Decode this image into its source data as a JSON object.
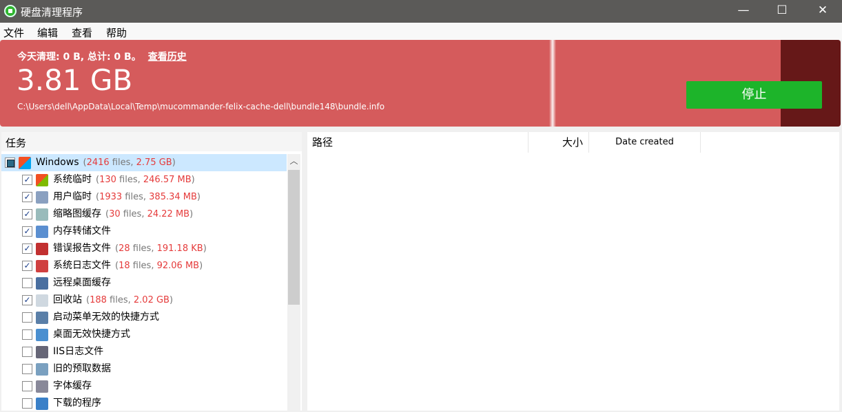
{
  "window": {
    "title": "硬盘清理程序",
    "minimize": "—",
    "maximize": "☐",
    "close": "✕"
  },
  "menu": [
    "文件",
    "编辑",
    "查看",
    "帮助"
  ],
  "banner": {
    "today_text": "今天清理: 0 B, 总计: 0 B。",
    "history_link": "查看历史",
    "size": "3.81 GB",
    "current_path": "C:\\Users\\dell\\AppData\\Local\\Temp\\mucommander-felix-cache-dell\\bundle148\\bundle.info",
    "stop_label": "停止",
    "colors": {
      "banner": "#d55b5c",
      "stop": "#1db42a"
    }
  },
  "tasks": {
    "header": "任务",
    "root": {
      "label": "Windows",
      "files": "2416 files",
      "size": "2.75 GB",
      "icon": "windows-flag-icon"
    },
    "items": [
      {
        "label": "系统临时",
        "files": "130 files",
        "size": "246.57 MB",
        "checked": true,
        "icon": "windows-flag-icon"
      },
      {
        "label": "用户临时",
        "files": "1933 files",
        "size": "385.34 MB",
        "checked": true,
        "icon": "user-file-icon"
      },
      {
        "label": "缩略图缓存",
        "files": "30 files",
        "size": "24.22 MB",
        "checked": true,
        "icon": "thumbnail-icon"
      },
      {
        "label": "内存转储文件",
        "checked": true,
        "icon": "memory-dump-icon"
      },
      {
        "label": "错误报告文件",
        "files": "28 files",
        "size": "191.18 KB",
        "checked": true,
        "icon": "toolbox-icon"
      },
      {
        "label": "系统日志文件",
        "files": "18 files",
        "size": "92.06 MB",
        "checked": true,
        "icon": "log-tools-icon"
      },
      {
        "label": "远程桌面缓存",
        "checked": false,
        "icon": "remote-desktop-icon"
      },
      {
        "label": "回收站",
        "files": "188 files",
        "size": "2.02 GB",
        "checked": true,
        "icon": "recycle-bin-icon"
      },
      {
        "label": "启动菜单无效的快捷方式",
        "checked": false,
        "icon": "shortcut-icon"
      },
      {
        "label": "桌面无效快捷方式",
        "checked": false,
        "icon": "desktop-shortcut-icon"
      },
      {
        "label": "IIS日志文件",
        "checked": false,
        "icon": "iis-log-icon"
      },
      {
        "label": "旧的预取数据",
        "checked": false,
        "icon": "prefetch-icon"
      },
      {
        "label": "字体缓存",
        "checked": false,
        "icon": "font-icon"
      },
      {
        "label": "下载的程序",
        "checked": false,
        "icon": "download-program-icon"
      }
    ]
  },
  "details": {
    "columns": [
      "路径",
      "大小",
      "Date created"
    ]
  }
}
